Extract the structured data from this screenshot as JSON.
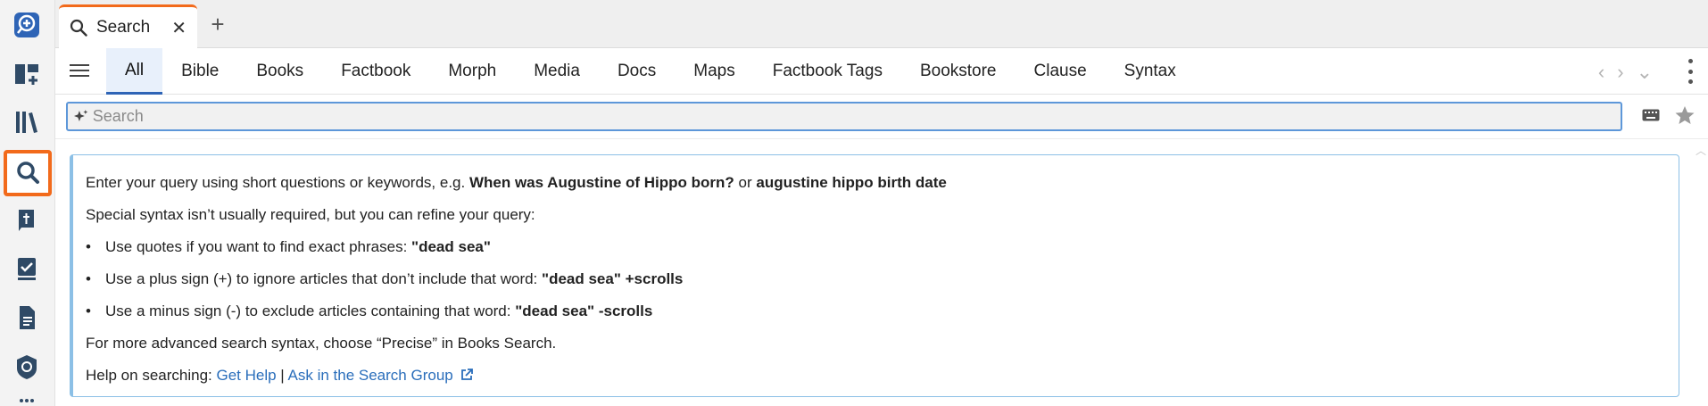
{
  "tab": {
    "label": "Search",
    "close": "✕",
    "new": "+"
  },
  "categories": [
    "All",
    "Bible",
    "Books",
    "Factbook",
    "Morph",
    "Media",
    "Docs",
    "Maps",
    "Factbook Tags",
    "Bookstore",
    "Clause",
    "Syntax"
  ],
  "search": {
    "placeholder": "Search",
    "value": ""
  },
  "nav": {
    "back": "‹",
    "forward": "›",
    "more": "⌄"
  },
  "info": {
    "intro_prefix": "Enter your query using short questions or keywords, e.g. ",
    "example1": "When was Augustine of Hippo born?",
    "or": " or ",
    "example2": "augustine hippo birth date",
    "special": "Special syntax isn’t usually required, but you can refine your query:",
    "tips": [
      {
        "text": "Use quotes if you want to find exact phrases: ",
        "example": "\"dead sea\""
      },
      {
        "text": "Use a plus sign (+) to ignore articles that don’t include that word: ",
        "example": "\"dead sea\" +scrolls"
      },
      {
        "text": "Use a minus sign (-) to exclude articles containing that word: ",
        "example": "\"dead sea\" -scrolls"
      }
    ],
    "advanced": "For more advanced search syntax, choose “Precise” in Books Search.",
    "help_prefix": "Help on searching: ",
    "help_link": "Get Help",
    "separator": " | ",
    "group_link": "Ask in the Search Group"
  },
  "colors": {
    "accent": "#f26a1b",
    "brand": "#2e64b6",
    "link": "#2a6ebb",
    "panel_border": "#8cc0e6"
  }
}
